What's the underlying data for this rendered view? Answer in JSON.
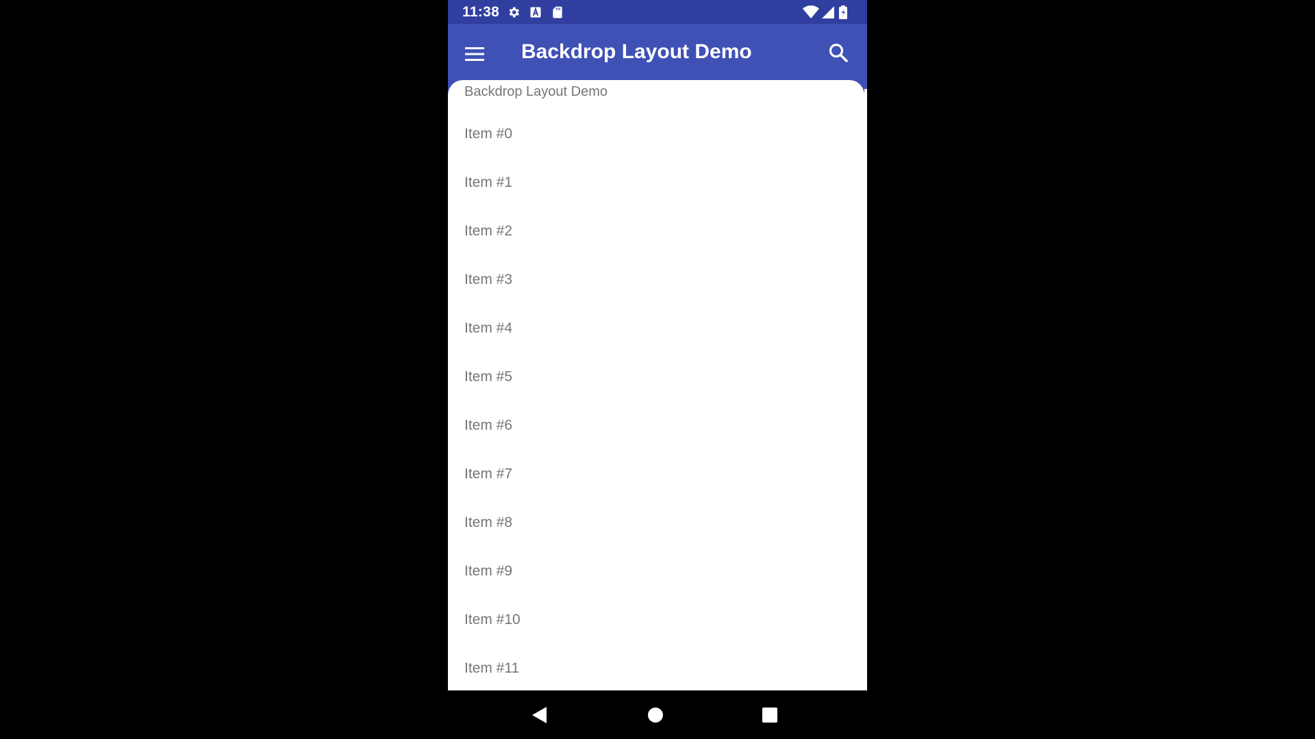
{
  "status_bar": {
    "time": "11:38",
    "icons": [
      "gear-icon",
      "a-badge-icon",
      "sd-card-icon",
      "wifi-icon",
      "cell-signal-icon",
      "battery-icon"
    ]
  },
  "app_bar": {
    "title": "Backdrop Layout Demo",
    "menu_icon": "hamburger-menu-icon",
    "search_icon": "search-icon",
    "color": "#3f51b5",
    "status_color": "#303f9f"
  },
  "front_layer": {
    "header": "Backdrop Layout Demo",
    "items": [
      "Item #0",
      "Item #1",
      "Item #2",
      "Item #3",
      "Item #4",
      "Item #5",
      "Item #6",
      "Item #7",
      "Item #8",
      "Item #9",
      "Item #10",
      "Item #11"
    ]
  },
  "nav_bar": {
    "buttons": [
      "back-icon",
      "home-icon",
      "recents-icon"
    ]
  }
}
